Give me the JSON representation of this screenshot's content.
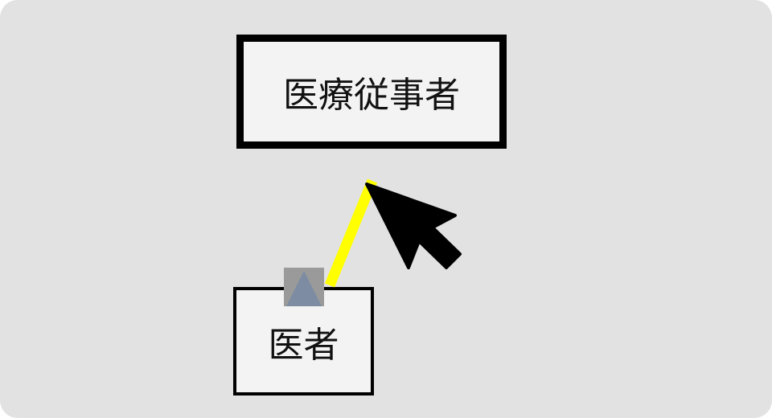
{
  "diagram": {
    "nodes": [
      {
        "id": "parent",
        "label": "医療従事者"
      },
      {
        "id": "child",
        "label": "医者"
      }
    ],
    "edges": [
      {
        "from": "child",
        "to": "parent",
        "type": "generalization",
        "state": "being-drawn"
      }
    ]
  },
  "colors": {
    "canvas": "#e2e2e2",
    "node_fill": "#f3f3f3",
    "node_border": "#000000",
    "connector": "#ffff00",
    "handle": "#9a9a9a",
    "arrowhead": "#7d8ca3",
    "cursor": "#000000"
  },
  "icons": {
    "handle": "generalization-triangle-icon",
    "cursor": "mouse-pointer-icon"
  }
}
